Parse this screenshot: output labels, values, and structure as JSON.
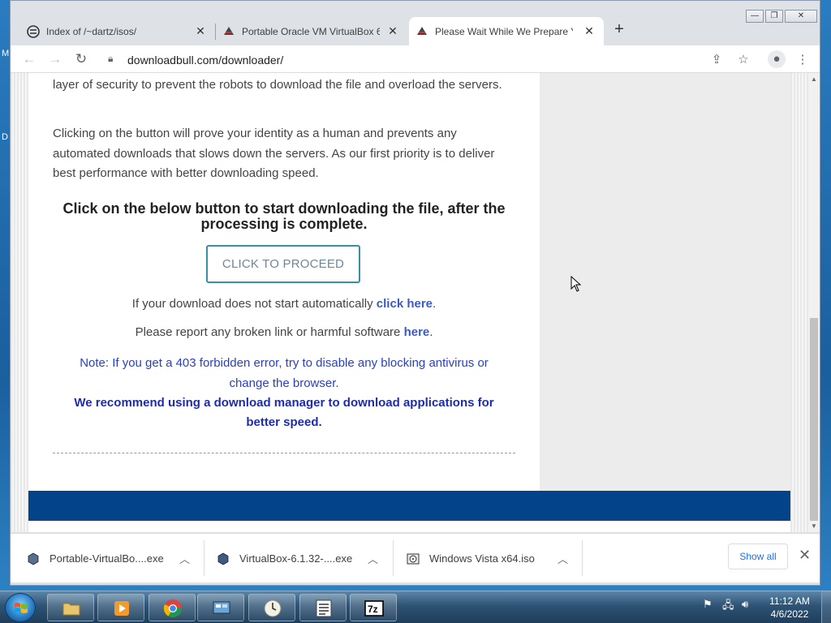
{
  "desktop": {
    "edge_text_1": "M",
    "edge_text_2": "D"
  },
  "window": {
    "minimize_glyph": "—",
    "maximize_glyph": "❐",
    "close_glyph": "✕"
  },
  "tabs": [
    {
      "title": "Index of /~dartz/isos/",
      "active": false,
      "icon": "server-icon"
    },
    {
      "title": "Portable Oracle VM VirtualBox 6.",
      "active": false,
      "icon": "ninja-icon"
    },
    {
      "title": "Please Wait While We Prepare Yo",
      "active": true,
      "icon": "ninja-icon"
    }
  ],
  "toolbar": {
    "url": "downloadbull.com/downloader/"
  },
  "page": {
    "para1": "layer of security to prevent the robots to download the file and overload the servers.",
    "para2": "Clicking on the button will prove your identity as a human and prevents any automated downloads that slows down the servers. As our first priority is to deliver best performance with better downloading speed.",
    "heading": "Click on the below button to start downloading the file, after the processing is complete.",
    "proceed_label": "CLICK TO PROCEED",
    "auto_text": "If your download does not start automatically ",
    "auto_link": "click here",
    "auto_end": ".",
    "report_text": "Please report any broken link or harmful software ",
    "report_link": "here",
    "report_end": ".",
    "note": "Note: If you get a 403 forbidden error, try to disable any blocking antivirus or change the browser.",
    "recommend": "We recommend using a download manager to download applications for better speed."
  },
  "downloads": [
    {
      "name": "Portable-VirtualBo....exe",
      "icon": "virtualbox-icon"
    },
    {
      "name": "VirtualBox-6.1.32-....exe",
      "icon": "virtualbox-icon"
    },
    {
      "name": "Windows Vista x64.iso",
      "icon": "disc-image-icon"
    }
  ],
  "shelf": {
    "show_all": "Show all"
  },
  "taskbar": {
    "apps": [
      "file-explorer",
      "media-player",
      "chrome",
      "control-panel",
      "clock-app",
      "notes-list",
      "7zip"
    ],
    "time": "11:12 AM",
    "date": "4/6/2022"
  },
  "colors": {
    "footer": "#03438a",
    "link": "#3a5bc7",
    "note": "#2a3fc4",
    "proceed_border": "#3a8fa8"
  }
}
